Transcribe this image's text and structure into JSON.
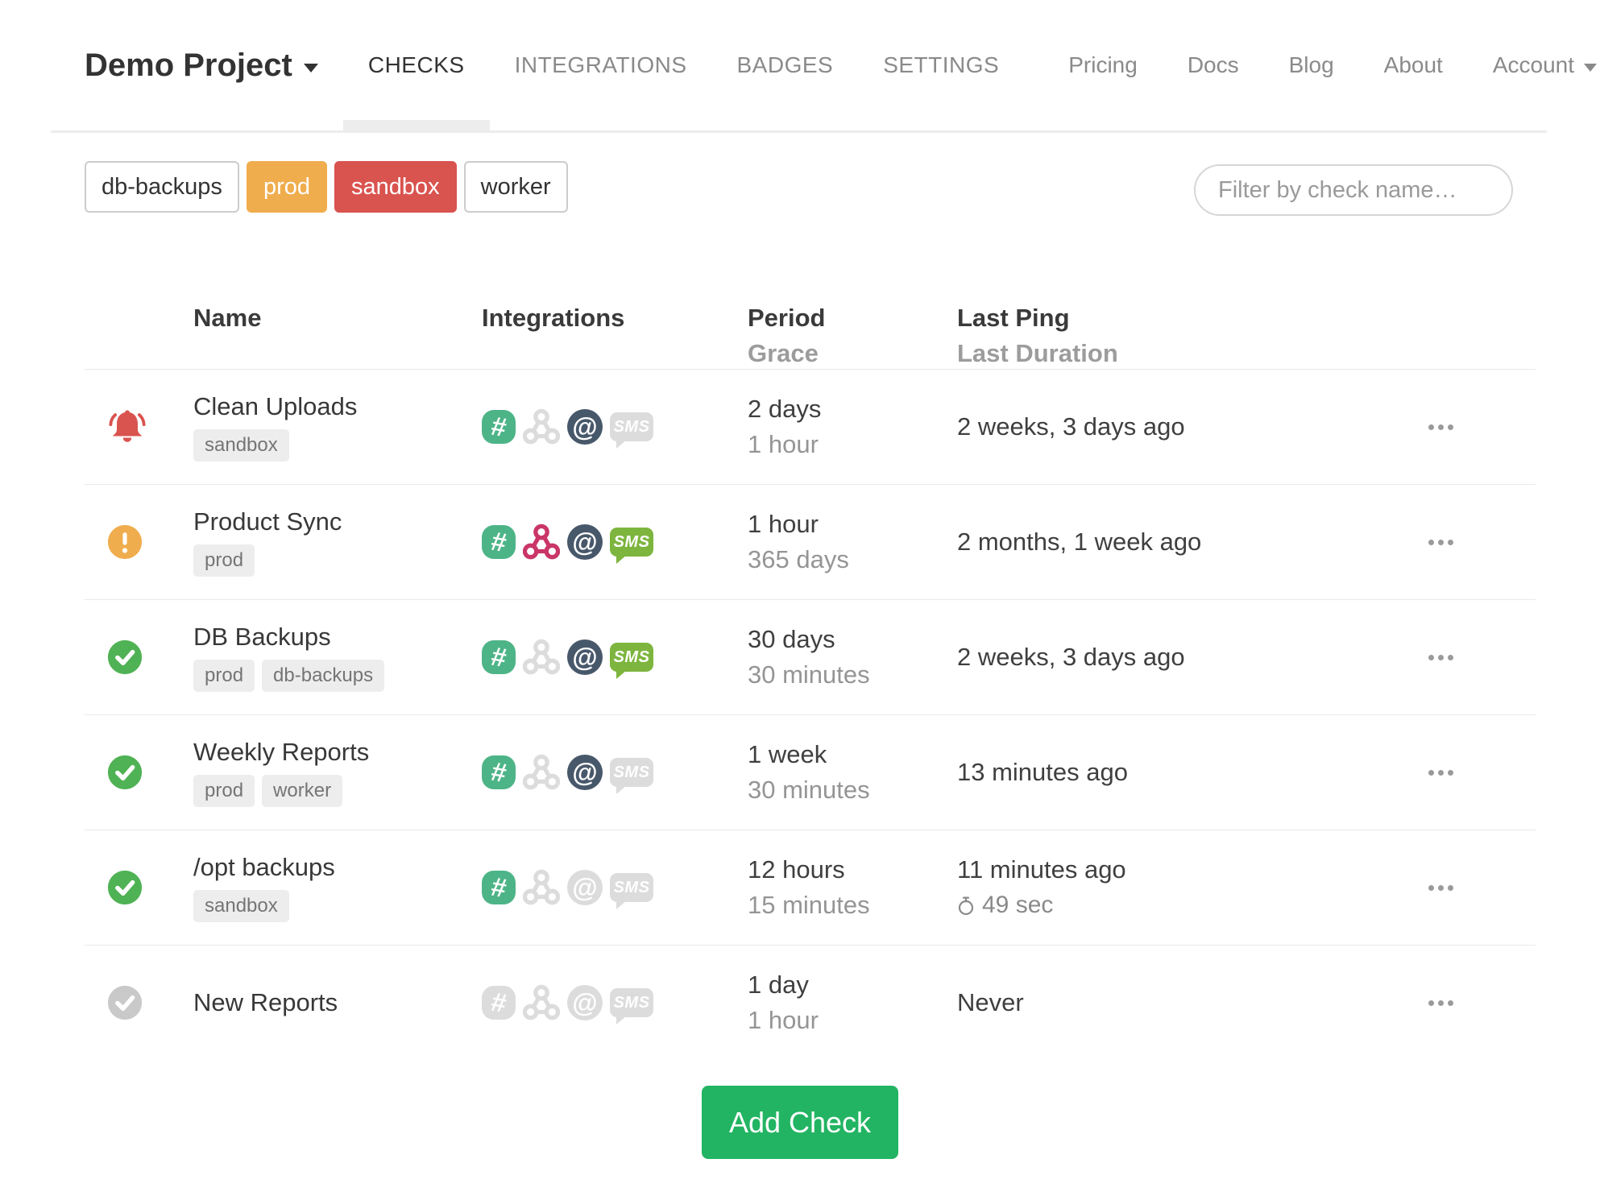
{
  "nav": {
    "brand": "Demo Project",
    "tabs": [
      {
        "label": "CHECKS",
        "active": true
      },
      {
        "label": "INTEGRATIONS",
        "active": false
      },
      {
        "label": "BADGES",
        "active": false
      },
      {
        "label": "SETTINGS",
        "active": false
      }
    ],
    "links": [
      {
        "label": "Pricing",
        "dropdown": false
      },
      {
        "label": "Docs",
        "dropdown": false
      },
      {
        "label": "Blog",
        "dropdown": false
      },
      {
        "label": "About",
        "dropdown": false
      },
      {
        "label": "Account",
        "dropdown": true
      }
    ]
  },
  "filters": {
    "tags": [
      {
        "label": "db-backups",
        "variant": "outline"
      },
      {
        "label": "prod",
        "variant": "amber"
      },
      {
        "label": "sandbox",
        "variant": "red"
      },
      {
        "label": "worker",
        "variant": "outline"
      }
    ],
    "search_placeholder": "Filter by check name…"
  },
  "table": {
    "headers": {
      "name": "Name",
      "integrations": "Integrations",
      "period": "Period",
      "grace": "Grace",
      "last_ping": "Last Ping",
      "last_duration": "Last Duration"
    }
  },
  "checks": [
    {
      "name": "Clean Uploads",
      "status": "alert",
      "tags": [
        "sandbox"
      ],
      "integrations": {
        "slack": true,
        "webhook": false,
        "email": true,
        "sms": false
      },
      "period": "2 days",
      "grace": "1 hour",
      "last_ping": "2 weeks, 3 days ago",
      "last_duration": ""
    },
    {
      "name": "Product Sync",
      "status": "grace",
      "tags": [
        "prod"
      ],
      "integrations": {
        "slack": true,
        "webhook": true,
        "email": true,
        "sms": true
      },
      "period": "1 hour",
      "grace": "365 days",
      "last_ping": "2 months, 1 week ago",
      "last_duration": ""
    },
    {
      "name": "DB Backups",
      "status": "up",
      "tags": [
        "prod",
        "db-backups"
      ],
      "integrations": {
        "slack": true,
        "webhook": false,
        "email": true,
        "sms": true
      },
      "period": "30 days",
      "grace": "30 minutes",
      "last_ping": "2 weeks, 3 days ago",
      "last_duration": ""
    },
    {
      "name": "Weekly Reports",
      "status": "up",
      "tags": [
        "prod",
        "worker"
      ],
      "integrations": {
        "slack": true,
        "webhook": false,
        "email": true,
        "sms": false
      },
      "period": "1 week",
      "grace": "30 minutes",
      "last_ping": "13 minutes ago",
      "last_duration": ""
    },
    {
      "name": "/opt backups",
      "status": "up",
      "tags": [
        "sandbox"
      ],
      "integrations": {
        "slack": true,
        "webhook": false,
        "email": false,
        "sms": false
      },
      "period": "12 hours",
      "grace": "15 minutes",
      "last_ping": "11 minutes ago",
      "last_duration": "49 sec"
    },
    {
      "name": "New Reports",
      "status": "new",
      "tags": [],
      "integrations": {
        "slack": false,
        "webhook": false,
        "email": false,
        "sms": false
      },
      "period": "1 day",
      "grace": "1 hour",
      "last_ping": "Never",
      "last_duration": ""
    }
  ],
  "add_check_label": "Add Check",
  "colors": {
    "slack_active": "#4db487",
    "webhook_active": "#c93667",
    "email_active": "#48586b",
    "sms_active": "#7db53e",
    "icon_inactive": "#dcdcdc",
    "status_up": "#4fb254",
    "status_new": "#c9c9c9",
    "status_grace": "#f0ad4e",
    "status_alert": "#d9534f",
    "accent_green": "#22b462",
    "tag_amber": "#f0ad4e",
    "tag_red": "#d9534f",
    "tag_outline_border": "#cccccc"
  }
}
